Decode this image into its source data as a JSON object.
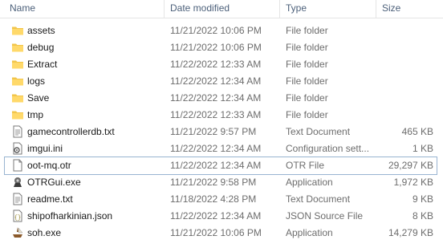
{
  "columns": {
    "name": "Name",
    "date": "Date modified",
    "type": "Type",
    "size": "Size"
  },
  "files": [
    {
      "name": "assets",
      "date": "11/21/2022 10:06 PM",
      "type": "File folder",
      "size": "",
      "icon": "folder-icon"
    },
    {
      "name": "debug",
      "date": "11/21/2022 10:06 PM",
      "type": "File folder",
      "size": "",
      "icon": "folder-icon"
    },
    {
      "name": "Extract",
      "date": "11/22/2022 12:33 AM",
      "type": "File folder",
      "size": "",
      "icon": "folder-icon"
    },
    {
      "name": "logs",
      "date": "11/22/2022 12:34 AM",
      "type": "File folder",
      "size": "",
      "icon": "folder-icon"
    },
    {
      "name": "Save",
      "date": "11/22/2022 12:34 AM",
      "type": "File folder",
      "size": "",
      "icon": "folder-icon"
    },
    {
      "name": "tmp",
      "date": "11/22/2022 12:33 AM",
      "type": "File folder",
      "size": "",
      "icon": "folder-icon"
    },
    {
      "name": "gamecontrollerdb.txt",
      "date": "11/21/2022 9:57 PM",
      "type": "Text Document",
      "size": "465 KB",
      "icon": "text-file-icon"
    },
    {
      "name": "imgui.ini",
      "date": "11/22/2022 12:34 AM",
      "type": "Configuration sett...",
      "size": "1 KB",
      "icon": "config-file-icon"
    },
    {
      "name": "oot-mq.otr",
      "date": "11/22/2022 12:34 AM",
      "type": "OTR File",
      "size": "29,297 KB",
      "icon": "blank-file-icon",
      "selected": true
    },
    {
      "name": "OTRGui.exe",
      "date": "11/21/2022 9:58 PM",
      "type": "Application",
      "size": "1,972 KB",
      "icon": "otrgui-app-icon"
    },
    {
      "name": "readme.txt",
      "date": "11/18/2022 4:28 PM",
      "type": "Text Document",
      "size": "9 KB",
      "icon": "text-file-icon"
    },
    {
      "name": "shipofharkinian.json",
      "date": "11/22/2022 12:34 AM",
      "type": "JSON Source File",
      "size": "8 KB",
      "icon": "json-file-icon"
    },
    {
      "name": "soh.exe",
      "date": "11/21/2022 10:06 PM",
      "type": "Application",
      "size": "14,279 KB",
      "icon": "soh-app-icon"
    }
  ]
}
